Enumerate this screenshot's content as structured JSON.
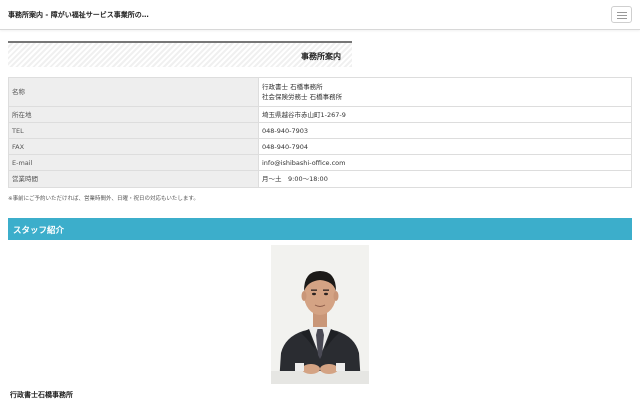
{
  "header": {
    "site_title": "事務所案内 - 障がい福祉サービス事業所の…",
    "menu_icon": "hamburger-menu-icon"
  },
  "office": {
    "heading": "事務所案内",
    "rows": [
      {
        "label": "名称",
        "lines": [
          "行政書士 石橋事務所",
          "社会保険労務士 石橋事務所"
        ]
      },
      {
        "label": "所在地",
        "lines": [
          "埼玉県越谷市赤山町1-267-9"
        ]
      },
      {
        "label": "TEL",
        "lines": [
          "048-940-7903"
        ]
      },
      {
        "label": "FAX",
        "lines": [
          "048-940-7904"
        ]
      },
      {
        "label": "E-mail",
        "lines": [
          "info@ishibashi-office.com"
        ]
      },
      {
        "label": "営業時間",
        "lines": [
          "月～土　9:00～18:00"
        ]
      }
    ],
    "note": "※事前にご予約いただければ、営業時間外、日曜・祝日の対応もいたします。"
  },
  "staff": {
    "heading": "スタッフ紹介",
    "name": "行政書士石橋事務所"
  },
  "colors": {
    "accent": "#3caecb",
    "label_bg": "#eeeeee",
    "border": "#dddddd"
  }
}
